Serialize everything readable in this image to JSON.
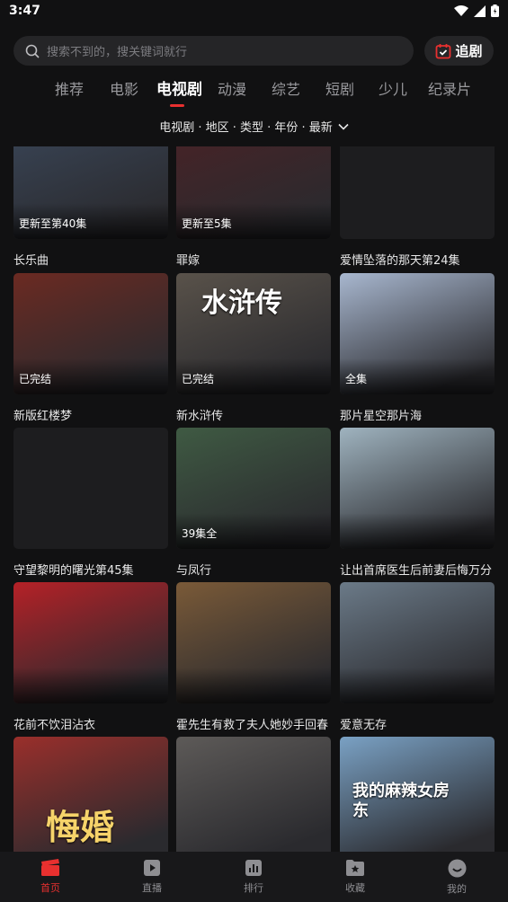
{
  "status_bar": {
    "time": "3:47"
  },
  "search": {
    "placeholder": "搜索不到的，搜关键词就行"
  },
  "follow_button": {
    "label": "追剧"
  },
  "tabs": [
    {
      "label": "推荐"
    },
    {
      "label": "电影"
    },
    {
      "label": "电视剧"
    },
    {
      "label": "动漫"
    },
    {
      "label": "综艺"
    },
    {
      "label": "短剧"
    },
    {
      "label": "少儿"
    },
    {
      "label": "纪录片"
    }
  ],
  "active_tab": "电视剧",
  "filter": {
    "label": "电视剧 · 地区 · 类型 · 年份 · 最新"
  },
  "items": [
    {
      "title": "长乐曲",
      "badge": "更新至第40集",
      "tone": "#3a4658"
    },
    {
      "title": "罪嫁",
      "badge": "更新至5集",
      "tone": "#4a2226"
    },
    {
      "title": "爱情坠落的那天第24集",
      "badge": "",
      "tone": "#1d1d1f"
    },
    {
      "title": "新版红楼梦",
      "badge": "已完结",
      "tone": "#6b2a22"
    },
    {
      "title": "新水浒传",
      "badge": "已完结",
      "tone": "#59524a"
    },
    {
      "title": "那片星空那片海",
      "badge": "全集",
      "tone": "#a8b7cf"
    },
    {
      "title": "守望黎明的曙光第45集",
      "badge": "",
      "tone": "#1d1d1f"
    },
    {
      "title": "与凤行",
      "badge": "39集全",
      "tone": "#3f5a43"
    },
    {
      "title": "让出首席医生后前妻后悔万分",
      "badge": "",
      "tone": "#9fb3bf"
    },
    {
      "title": "花前不饮泪沾衣",
      "badge": "",
      "tone": "#b52127"
    },
    {
      "title": "霍先生有救了夫人她妙手回春",
      "badge": "",
      "tone": "#7a5a38"
    },
    {
      "title": "爱意无存",
      "badge": "",
      "tone": "#6b7a88"
    },
    {
      "title": "",
      "badge": "",
      "tone": "#9a2f2b"
    },
    {
      "title": "",
      "badge": "",
      "tone": "#5d5a58"
    },
    {
      "title": "",
      "badge": "",
      "tone": "#7aa1c4"
    }
  ],
  "poster_texts": {
    "shuihu": "水浒传",
    "huihun": "悔婚",
    "mala": "我的麻辣女房东"
  },
  "bottom_nav": [
    {
      "label": "首页",
      "icon": "clapper-icon"
    },
    {
      "label": "直播",
      "icon": "play-icon"
    },
    {
      "label": "排行",
      "icon": "chart-icon"
    },
    {
      "label": "收藏",
      "icon": "star-folder-icon"
    },
    {
      "label": "我的",
      "icon": "smile-icon"
    }
  ],
  "colors": {
    "accent": "#e8302f",
    "background": "#111112",
    "surface": "#252527"
  }
}
